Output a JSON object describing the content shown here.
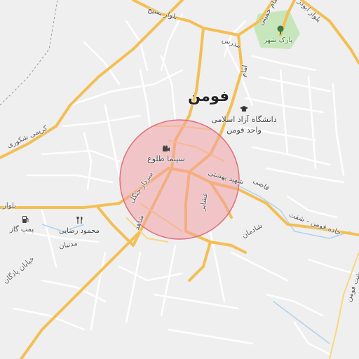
{
  "map": {
    "city_label": "فومن",
    "places": {
      "university": "دانشگاه آزاد اسلامی\nواحد فومن",
      "cinema": "سینما طلوع",
      "park": "پارک شهر",
      "gas_station": "پمپ گاز",
      "mahmoud_rezaei": "محمود رضایی"
    },
    "roads": {
      "basij_blvd": "بلوار بسیج",
      "madres": "مدرس",
      "martyr_beheshti": "شهید بهشتی",
      "sardar_jangal": "سردار جنگل",
      "bolvar": "بلوار",
      "jadeh_fouman_shaft": "جاده فومن - شفت",
      "shahed": "شاهد",
      "ashayer": "عشایر",
      "emam": "امام",
      "shaghaman": "شادمان",
      "ghazi": "قاضی",
      "shahid_madani_top": "دانشگاه",
      "karimi_shakouri": "کریمی شکوری",
      "madnian": "مدنیان",
      "khiaban_padegan": "خیابان پادگان",
      "behesht_fouman": "بهشت فومن",
      "bolvar_abuzar": "بلوار ابوذر",
      "emam_khomeini": "امام خمینی"
    },
    "highlight": {
      "fill": "#f2a0a6",
      "stroke": "#e0707c"
    },
    "colors": {
      "background": "#efefef",
      "road_major": "#f7c85e",
      "road_minor": "#ffffff",
      "park": "#c8e6bc",
      "water": "#aed3ee"
    }
  }
}
